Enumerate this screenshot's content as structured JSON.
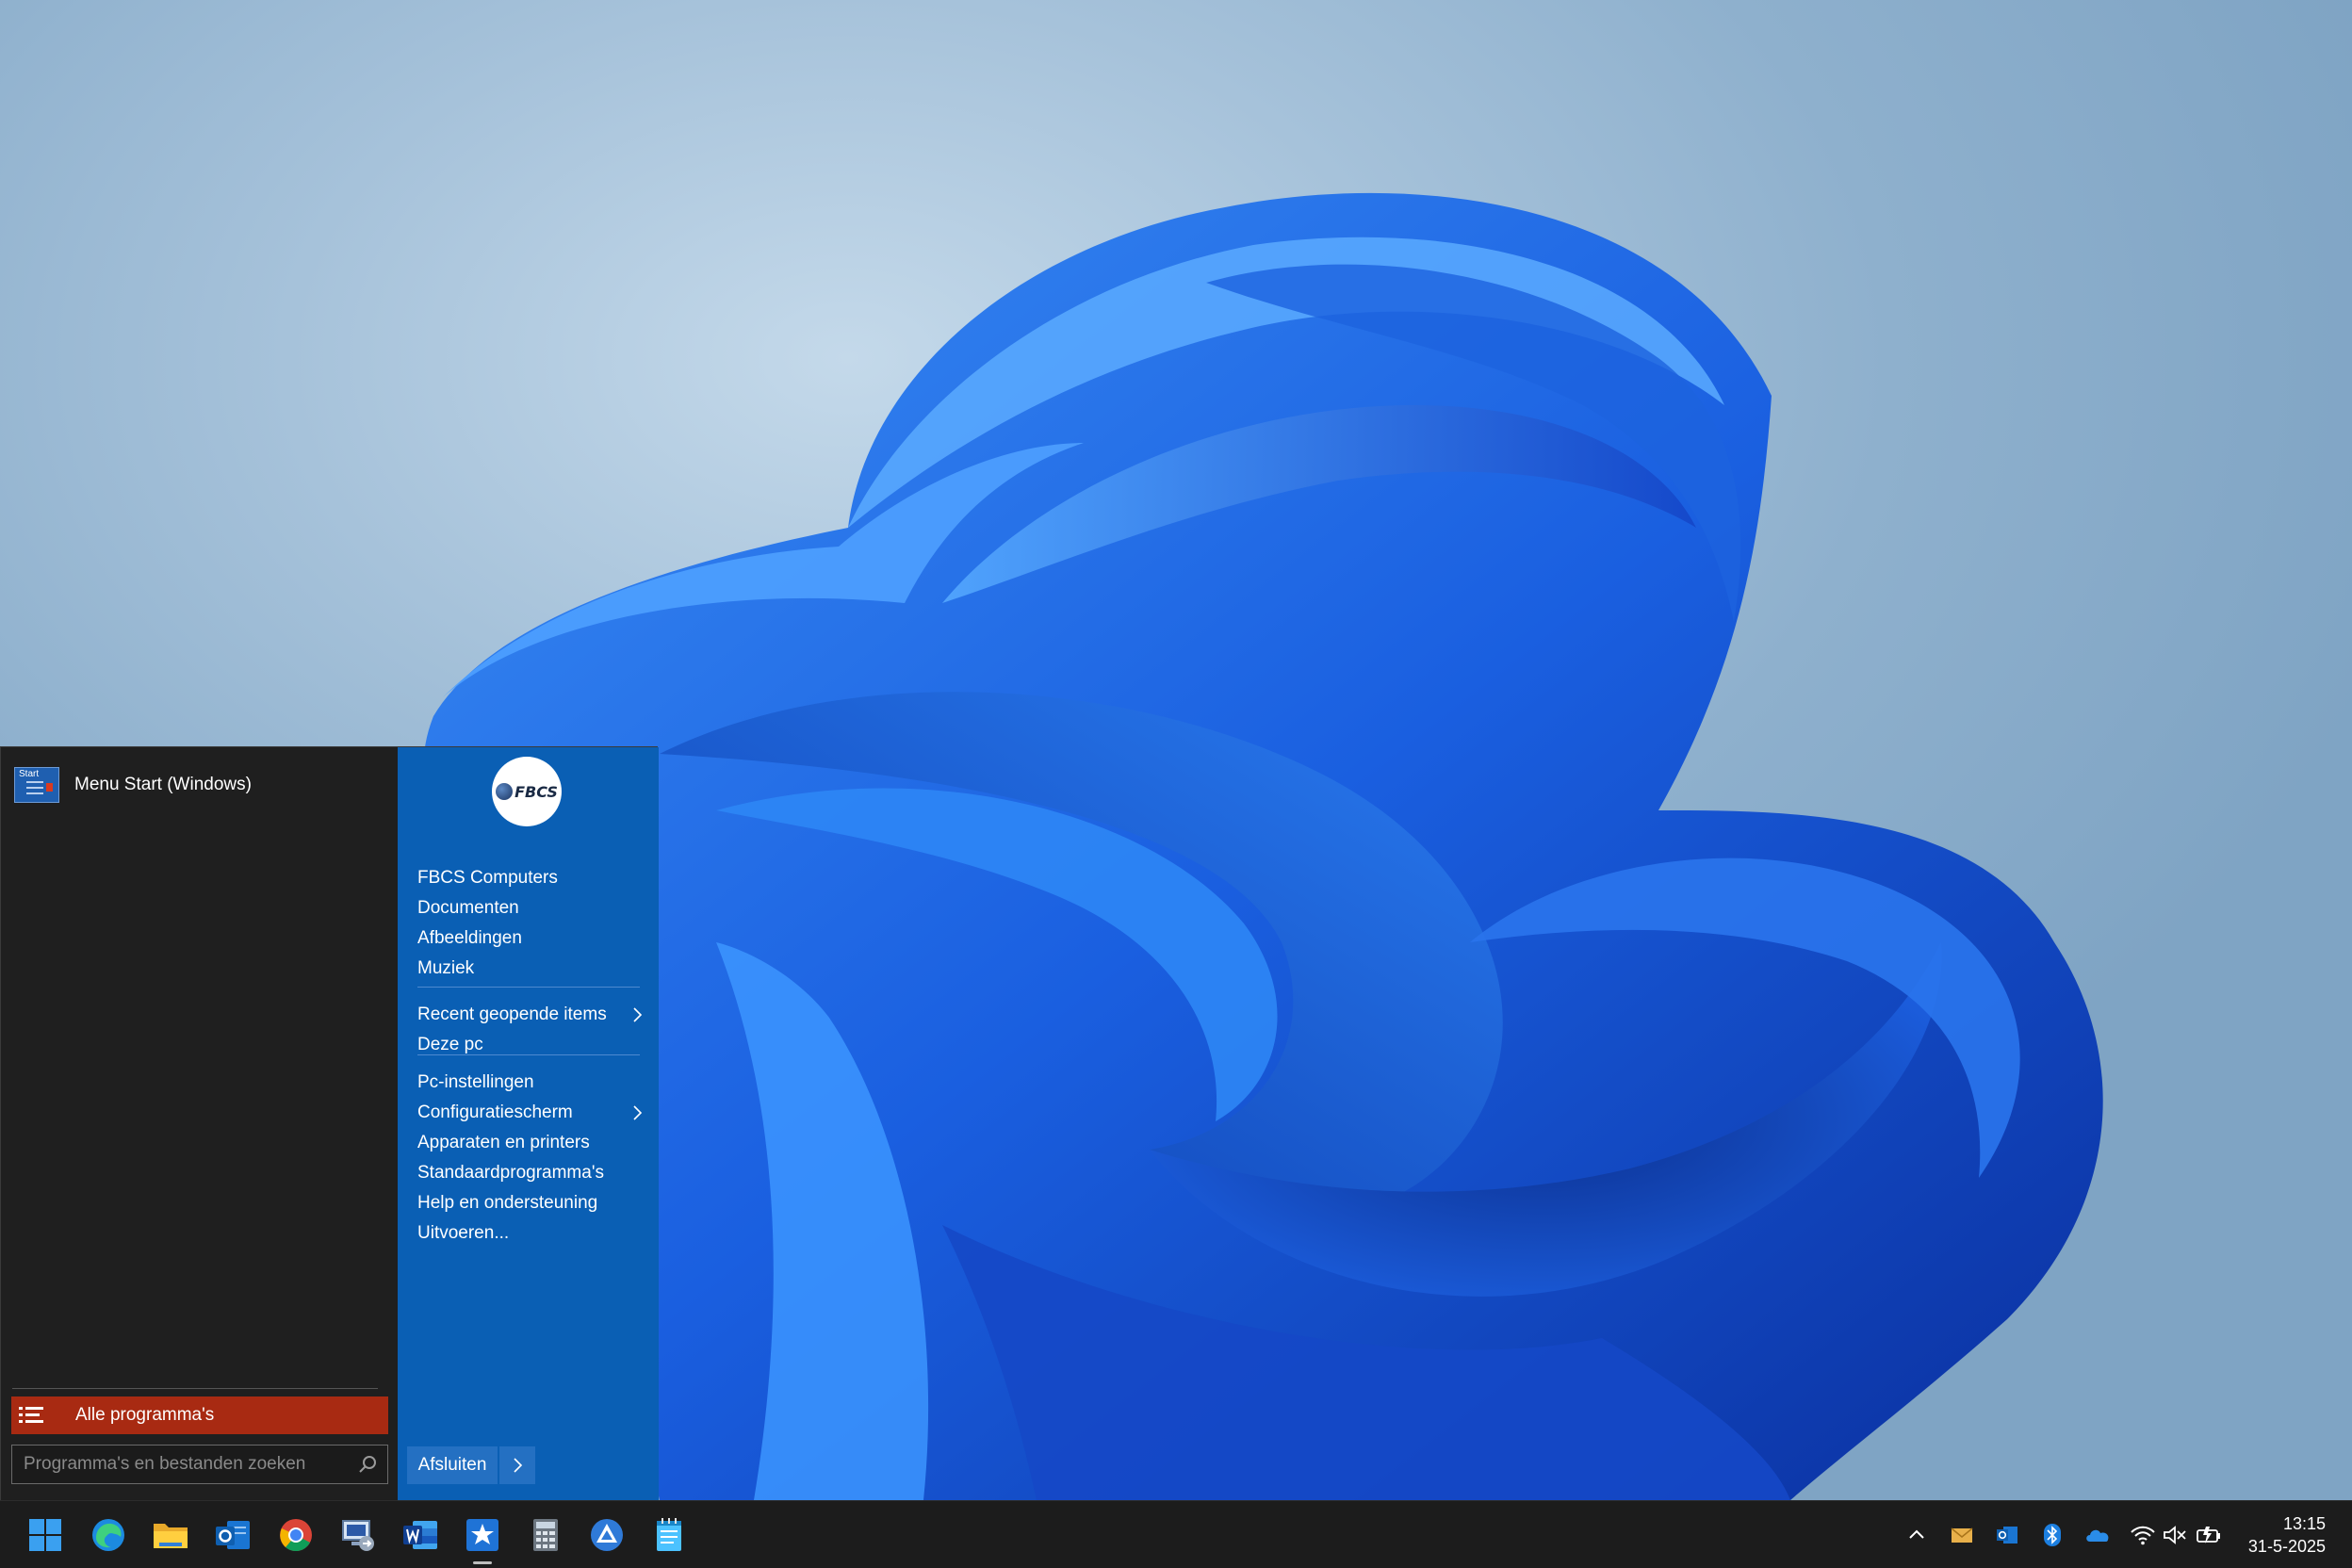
{
  "start_menu": {
    "pinned": {
      "label": "Menu Start (Windows)",
      "icon_text": "Start",
      "icon": "start-menu-app-icon"
    },
    "all_programs": "Alle programma's",
    "search": {
      "placeholder": "Programma's en bestanden zoeken",
      "value": ""
    },
    "logo": {
      "text": "FBCS"
    },
    "right_items": [
      {
        "label": "FBCS Computers"
      },
      {
        "label": "Documenten"
      },
      {
        "label": "Afbeeldingen"
      },
      {
        "label": "Muziek"
      },
      {
        "label": "Recent geopende items",
        "submenu": true
      },
      {
        "label": "Deze pc"
      },
      {
        "label": "Pc-instellingen"
      },
      {
        "label": "Configuratiescherm",
        "submenu": true
      },
      {
        "label": "Apparaten en printers"
      },
      {
        "label": "Standaardprogramma's"
      },
      {
        "label": "Help en ondersteuning"
      },
      {
        "label": "Uitvoeren..."
      }
    ],
    "shutdown": "Afsluiten"
  },
  "taskbar": {
    "apps": [
      {
        "name": "windows-start-icon"
      },
      {
        "name": "edge-browser-icon"
      },
      {
        "name": "file-explorer-icon"
      },
      {
        "name": "outlook-icon"
      },
      {
        "name": "chrome-icon"
      },
      {
        "name": "remote-desktop-icon"
      },
      {
        "name": "word-icon"
      },
      {
        "name": "favorites-star-icon",
        "active": true
      },
      {
        "name": "calculator-icon"
      },
      {
        "name": "triangle-app-icon"
      },
      {
        "name": "notepad-icon"
      }
    ],
    "tray": [
      {
        "name": "show-hidden-icons-chevron-icon"
      },
      {
        "name": "mail-icon"
      },
      {
        "name": "outlook-tray-icon"
      },
      {
        "name": "bluetooth-icon"
      },
      {
        "name": "onedrive-cloud-icon"
      },
      {
        "name": "wifi-icon"
      },
      {
        "name": "speaker-muted-icon"
      },
      {
        "name": "battery-charging-icon"
      }
    ],
    "clock": {
      "time": "13:15",
      "date": "31-5-2025"
    }
  },
  "colors": {
    "start_left_bg": "#1f1f1f",
    "start_right_bg": "#0a5fb4",
    "all_programs_bg": "#a82a12",
    "taskbar_bg": "#1c1c1c"
  }
}
